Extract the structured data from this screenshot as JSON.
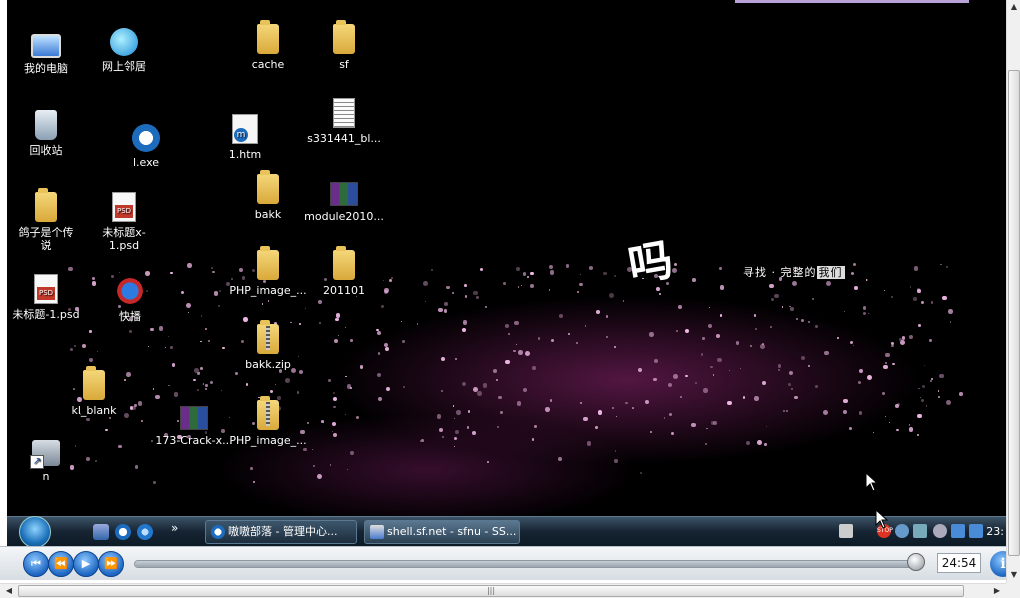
{
  "desktop": {
    "icons": [
      {
        "label": "我的电脑",
        "icon": "computer-icon"
      },
      {
        "label": "网上邻居",
        "icon": "network-icon"
      },
      {
        "label": "cache",
        "icon": "folder-icon"
      },
      {
        "label": "sf",
        "icon": "folder-icon"
      },
      {
        "label": "回收站",
        "icon": "recycle-bin-icon"
      },
      {
        "label": "l.exe",
        "icon": "maxthon-exe-icon"
      },
      {
        "label": "1.htm",
        "icon": "html-file-icon"
      },
      {
        "label": "s331441_bl...",
        "icon": "text-file-icon"
      },
      {
        "label": "bakk",
        "icon": "folder-icon"
      },
      {
        "label": "module2010...",
        "icon": "rar-archive-icon"
      },
      {
        "label": "鸽子是个传说",
        "icon": "folder-icon"
      },
      {
        "label": "未标题x-1.psd",
        "icon": "psd-file-icon"
      },
      {
        "label": "PHP_image_...",
        "icon": "folder-icon"
      },
      {
        "label": "201101",
        "icon": "folder-icon"
      },
      {
        "label": "未标题-1.psd",
        "icon": "psd-file-icon"
      },
      {
        "label": "快播",
        "icon": "kuaibo-player-icon"
      },
      {
        "label": "bakk.zip",
        "icon": "zip-folder-icon"
      },
      {
        "label": "kl_blank",
        "icon": "folder-icon"
      },
      {
        "label": "173-Crack-x...",
        "icon": "rar-archive-icon"
      },
      {
        "label": "PHP_image_...",
        "icon": "zip-folder-icon"
      },
      {
        "label": "n",
        "icon": "shortcut-icon"
      }
    ],
    "wallpaper_text": {
      "calligraphy": "吗",
      "slogan_prefix": "寻找 · 完整的",
      "slogan_highlight": "我们"
    }
  },
  "taskbar": {
    "tasks": [
      {
        "label": "嗷嗷部落 - 管理中心...",
        "active": false
      },
      {
        "label": "shell.sf.net - sfnu - SS...",
        "active": true
      }
    ],
    "clock": "23:"
  },
  "player": {
    "time": "24:54",
    "progress": 0.99,
    "buttons": [
      "skip-back",
      "rewind",
      "play",
      "fast-forward"
    ]
  },
  "colors": {
    "desktop_bg": "#000000",
    "accent_pink": "#f0b8e6",
    "player_blue": "#1d66c2"
  }
}
